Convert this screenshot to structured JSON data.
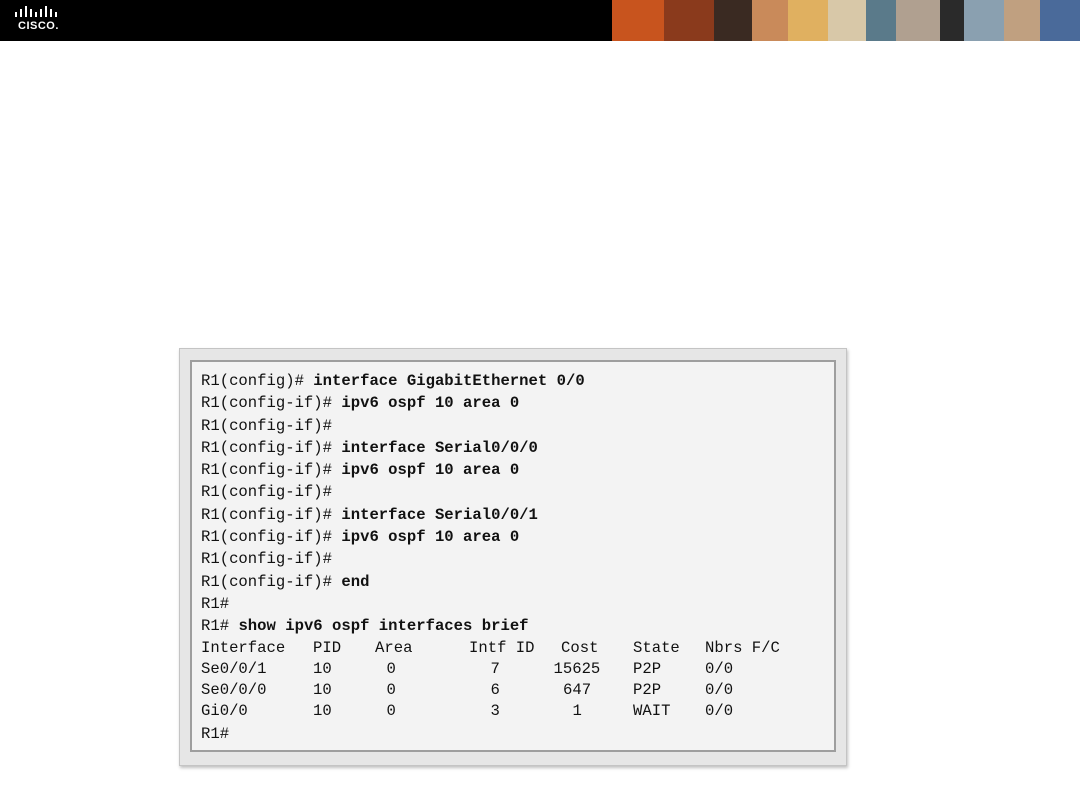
{
  "header": {
    "logo_text": "CISCO.",
    "photo_colors": [
      "#c8541e",
      "#8a3a1c",
      "#3a2a22",
      "#c98a5a",
      "#e0b060",
      "#d8c8a8",
      "#5a7a8a",
      "#b0a090",
      "#2a2a2a",
      "#8aa0b0",
      "#c0a080",
      "#4a6a9a"
    ]
  },
  "terminal": {
    "lines": [
      {
        "prompt": "R1(config)# ",
        "command": "interface GigabitEthernet 0/0"
      },
      {
        "prompt": "R1(config-if)# ",
        "command": "ipv6 ospf 10 area 0"
      },
      {
        "prompt": "R1(config-if)#",
        "command": ""
      },
      {
        "prompt": "R1(config-if)# ",
        "command": "interface Serial0/0/0"
      },
      {
        "prompt": "R1(config-if)# ",
        "command": "ipv6 ospf 10 area 0"
      },
      {
        "prompt": "R1(config-if)#",
        "command": ""
      },
      {
        "prompt": "R1(config-if)# ",
        "command": "interface Serial0/0/1"
      },
      {
        "prompt": "R1(config-if)# ",
        "command": "ipv6 ospf 10 area 0"
      },
      {
        "prompt": "R1(config-if)#",
        "command": ""
      },
      {
        "prompt": "R1(config-if)# ",
        "command": "end"
      },
      {
        "prompt": "R1#",
        "command": ""
      },
      {
        "prompt": "R1# ",
        "command": "show ipv6 ospf interfaces brief"
      }
    ],
    "table": {
      "headers": [
        "Interface",
        "PID",
        "Area",
        "Intf ID",
        "Cost",
        "State",
        "Nbrs F/C"
      ],
      "rows": [
        [
          "Se0/0/1",
          "10",
          "0",
          "7",
          "15625",
          "P2P",
          "0/0"
        ],
        [
          "Se0/0/0",
          "10",
          "0",
          "6",
          "647",
          "P2P",
          "0/0"
        ],
        [
          "Gi0/0",
          "10",
          "0",
          "3",
          "1",
          "WAIT",
          "0/0"
        ]
      ]
    },
    "final_prompt": "R1#"
  }
}
